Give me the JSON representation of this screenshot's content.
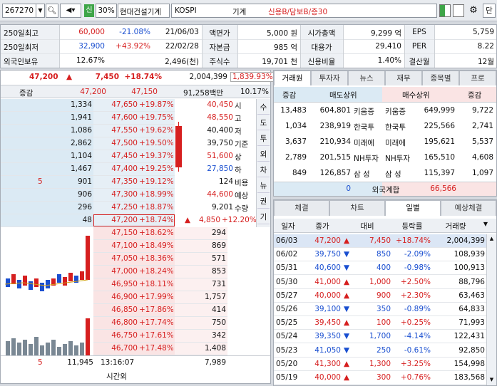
{
  "top": {
    "code": "267270",
    "view30": "30%",
    "name": "현대건설기계",
    "market": "KOSPI",
    "sector": "기계",
    "credit": "신용B/담보B/증30",
    "new": "신",
    "dan": "단"
  },
  "info": {
    "r1": [
      "250일최고",
      "60,000",
      "-21.08%",
      "21/06/03",
      "액면가",
      "5,000 원",
      "시가총액",
      "9,299 억",
      "EPS",
      "5,759"
    ],
    "r2": [
      "250일최저",
      "32,900",
      "+43.92%",
      "22/02/28",
      "자본금",
      "985 억",
      "대용가",
      "29,410",
      "PER",
      "8.22"
    ],
    "r3": [
      "외국인보유",
      "12.67%",
      "2,496(천)",
      "주식수",
      "19,701 천",
      "신용비율",
      "1.40%",
      "결산월",
      "12월"
    ]
  },
  "quote": {
    "price": "47,200",
    "arrow": "▲",
    "change": "7,450",
    "rate": "+18.74%",
    "volume": "2,004,399",
    "volrate": "1,839.93%"
  },
  "obhead": {
    "label": "증감",
    "p1": "47,200",
    "p2": "47,150",
    "amount": "91,258백만",
    "pct": "10.17%"
  },
  "asks": [
    [
      "1,334",
      "47,650",
      "+19.87%"
    ],
    [
      "1,941",
      "47,600",
      "+19.75%"
    ],
    [
      "1,086",
      "47,550",
      "+19.62%"
    ],
    [
      "2,862",
      "47,500",
      "+19.50%"
    ],
    [
      "1,104",
      "47,450",
      "+19.37%"
    ],
    [
      "1,467",
      "47,400",
      "+19.25%"
    ],
    [
      "901",
      "47,350",
      "+19.12%"
    ],
    [
      "906",
      "47,300",
      "+18.99%"
    ],
    [
      "296",
      "47,250",
      "+18.87%"
    ],
    [
      "48",
      "47,200",
      "+18.74%"
    ]
  ],
  "askChange5": "5",
  "bids": [
    [
      "47,150",
      "+18.62%",
      "294"
    ],
    [
      "47,100",
      "+18.49%",
      "869"
    ],
    [
      "47,050",
      "+18.36%",
      "571"
    ],
    [
      "47,000",
      "+18.24%",
      "853"
    ],
    [
      "46,950",
      "+18.11%",
      "731"
    ],
    [
      "46,900",
      "+17.99%",
      "1,757"
    ],
    [
      "46,850",
      "+17.86%",
      "414"
    ],
    [
      "46,800",
      "+17.74%",
      "750"
    ],
    [
      "46,750",
      "+17.61%",
      "342"
    ],
    [
      "46,700",
      "+17.48%",
      "1,408"
    ]
  ],
  "stats": [
    [
      "40,450",
      "시"
    ],
    [
      "48,550",
      "고"
    ],
    [
      "40,400",
      "저"
    ],
    [
      "39,750",
      "기준"
    ],
    [
      "51,600",
      "상"
    ],
    [
      "27,850",
      "하"
    ],
    [
      "124",
      "비용"
    ],
    [
      "44,600",
      "예상"
    ],
    [
      "9,201",
      "수량"
    ]
  ],
  "expected": {
    "arrow": "▲",
    "chg": "4,850",
    "rate": "+12.20%"
  },
  "sidetabs": [
    "수",
    "도",
    "투",
    "외",
    "차",
    "뉴",
    "권",
    "기"
  ],
  "footer": {
    "a": "5",
    "b": "11,945",
    "time": "13:16:07",
    "c": "7,989",
    "after": "시간외"
  },
  "tabs1": [
    "거래원",
    "투자자",
    "뉴스",
    "재무",
    "종목별",
    "프로"
  ],
  "broker": {
    "h1": "증감",
    "h2": "매도상위",
    "h3": "매수상위",
    "h4": "증감",
    "rows": [
      [
        "13,483",
        "604,801",
        "키움증",
        "키움증",
        "649,999",
        "9,722"
      ],
      [
        "1,034",
        "238,919",
        "한국투",
        "한국투",
        "225,566",
        "2,741"
      ],
      [
        "3,637",
        "210,934",
        "미래에",
        "미래에",
        "195,621",
        "5,537"
      ],
      [
        "2,789",
        "201,515",
        "NH투자",
        "NH투자",
        "165,510",
        "4,608"
      ],
      [
        "849",
        "126,857",
        "삼 성",
        "삼 성",
        "115,397",
        "1,097"
      ]
    ],
    "f1": "0",
    "f2": "외국계합",
    "f3": "66,566"
  },
  "tabs2": [
    "체결",
    "차트",
    "일별",
    "예상체결"
  ],
  "daily": {
    "head": [
      "일자",
      "종가",
      "대비",
      "등락률",
      "거래량"
    ],
    "rows": [
      [
        "06/03",
        "47,200",
        "▲",
        "7,450",
        "+18.74%",
        "2,004,399",
        "r"
      ],
      [
        "06/02",
        "39,750",
        "▼",
        "850",
        "-2.09%",
        "108,939",
        "b"
      ],
      [
        "05/31",
        "40,600",
        "▼",
        "400",
        "-0.98%",
        "100,913",
        "b"
      ],
      [
        "05/30",
        "41,000",
        "▲",
        "1,000",
        "+2.50%",
        "88,796",
        "r"
      ],
      [
        "05/27",
        "40,000",
        "▲",
        "900",
        "+2.30%",
        "63,463",
        "r"
      ],
      [
        "05/26",
        "39,100",
        "▼",
        "350",
        "-0.89%",
        "64,833",
        "b"
      ],
      [
        "05/25",
        "39,450",
        "▲",
        "100",
        "+0.25%",
        "71,993",
        "r"
      ],
      [
        "05/24",
        "39,350",
        "▼",
        "1,700",
        "-4.14%",
        "122,431",
        "b"
      ],
      [
        "05/23",
        "41,050",
        "▼",
        "250",
        "-0.61%",
        "92,850",
        "b"
      ],
      [
        "05/20",
        "41,300",
        "▲",
        "1,300",
        "+3.25%",
        "154,998",
        "r"
      ],
      [
        "05/19",
        "40,000",
        "▲",
        "300",
        "+0.76%",
        "183,568",
        "r"
      ]
    ]
  }
}
